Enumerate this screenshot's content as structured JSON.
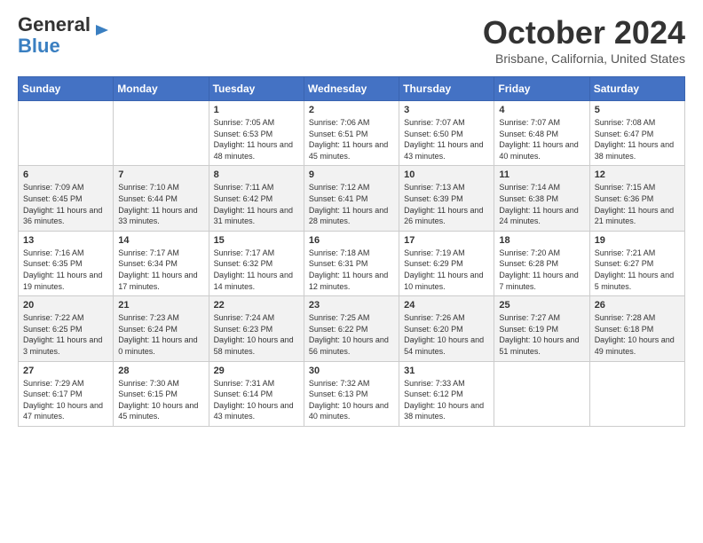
{
  "logo": {
    "line1": "General",
    "line2": "Blue"
  },
  "header": {
    "month": "October 2024",
    "location": "Brisbane, California, United States"
  },
  "columns": [
    "Sunday",
    "Monday",
    "Tuesday",
    "Wednesday",
    "Thursday",
    "Friday",
    "Saturday"
  ],
  "weeks": [
    [
      {
        "day": "",
        "info": ""
      },
      {
        "day": "",
        "info": ""
      },
      {
        "day": "1",
        "info": "Sunrise: 7:05 AM\nSunset: 6:53 PM\nDaylight: 11 hours and 48 minutes."
      },
      {
        "day": "2",
        "info": "Sunrise: 7:06 AM\nSunset: 6:51 PM\nDaylight: 11 hours and 45 minutes."
      },
      {
        "day": "3",
        "info": "Sunrise: 7:07 AM\nSunset: 6:50 PM\nDaylight: 11 hours and 43 minutes."
      },
      {
        "day": "4",
        "info": "Sunrise: 7:07 AM\nSunset: 6:48 PM\nDaylight: 11 hours and 40 minutes."
      },
      {
        "day": "5",
        "info": "Sunrise: 7:08 AM\nSunset: 6:47 PM\nDaylight: 11 hours and 38 minutes."
      }
    ],
    [
      {
        "day": "6",
        "info": "Sunrise: 7:09 AM\nSunset: 6:45 PM\nDaylight: 11 hours and 36 minutes."
      },
      {
        "day": "7",
        "info": "Sunrise: 7:10 AM\nSunset: 6:44 PM\nDaylight: 11 hours and 33 minutes."
      },
      {
        "day": "8",
        "info": "Sunrise: 7:11 AM\nSunset: 6:42 PM\nDaylight: 11 hours and 31 minutes."
      },
      {
        "day": "9",
        "info": "Sunrise: 7:12 AM\nSunset: 6:41 PM\nDaylight: 11 hours and 28 minutes."
      },
      {
        "day": "10",
        "info": "Sunrise: 7:13 AM\nSunset: 6:39 PM\nDaylight: 11 hours and 26 minutes."
      },
      {
        "day": "11",
        "info": "Sunrise: 7:14 AM\nSunset: 6:38 PM\nDaylight: 11 hours and 24 minutes."
      },
      {
        "day": "12",
        "info": "Sunrise: 7:15 AM\nSunset: 6:36 PM\nDaylight: 11 hours and 21 minutes."
      }
    ],
    [
      {
        "day": "13",
        "info": "Sunrise: 7:16 AM\nSunset: 6:35 PM\nDaylight: 11 hours and 19 minutes."
      },
      {
        "day": "14",
        "info": "Sunrise: 7:17 AM\nSunset: 6:34 PM\nDaylight: 11 hours and 17 minutes."
      },
      {
        "day": "15",
        "info": "Sunrise: 7:17 AM\nSunset: 6:32 PM\nDaylight: 11 hours and 14 minutes."
      },
      {
        "day": "16",
        "info": "Sunrise: 7:18 AM\nSunset: 6:31 PM\nDaylight: 11 hours and 12 minutes."
      },
      {
        "day": "17",
        "info": "Sunrise: 7:19 AM\nSunset: 6:29 PM\nDaylight: 11 hours and 10 minutes."
      },
      {
        "day": "18",
        "info": "Sunrise: 7:20 AM\nSunset: 6:28 PM\nDaylight: 11 hours and 7 minutes."
      },
      {
        "day": "19",
        "info": "Sunrise: 7:21 AM\nSunset: 6:27 PM\nDaylight: 11 hours and 5 minutes."
      }
    ],
    [
      {
        "day": "20",
        "info": "Sunrise: 7:22 AM\nSunset: 6:25 PM\nDaylight: 11 hours and 3 minutes."
      },
      {
        "day": "21",
        "info": "Sunrise: 7:23 AM\nSunset: 6:24 PM\nDaylight: 11 hours and 0 minutes."
      },
      {
        "day": "22",
        "info": "Sunrise: 7:24 AM\nSunset: 6:23 PM\nDaylight: 10 hours and 58 minutes."
      },
      {
        "day": "23",
        "info": "Sunrise: 7:25 AM\nSunset: 6:22 PM\nDaylight: 10 hours and 56 minutes."
      },
      {
        "day": "24",
        "info": "Sunrise: 7:26 AM\nSunset: 6:20 PM\nDaylight: 10 hours and 54 minutes."
      },
      {
        "day": "25",
        "info": "Sunrise: 7:27 AM\nSunset: 6:19 PM\nDaylight: 10 hours and 51 minutes."
      },
      {
        "day": "26",
        "info": "Sunrise: 7:28 AM\nSunset: 6:18 PM\nDaylight: 10 hours and 49 minutes."
      }
    ],
    [
      {
        "day": "27",
        "info": "Sunrise: 7:29 AM\nSunset: 6:17 PM\nDaylight: 10 hours and 47 minutes."
      },
      {
        "day": "28",
        "info": "Sunrise: 7:30 AM\nSunset: 6:15 PM\nDaylight: 10 hours and 45 minutes."
      },
      {
        "day": "29",
        "info": "Sunrise: 7:31 AM\nSunset: 6:14 PM\nDaylight: 10 hours and 43 minutes."
      },
      {
        "day": "30",
        "info": "Sunrise: 7:32 AM\nSunset: 6:13 PM\nDaylight: 10 hours and 40 minutes."
      },
      {
        "day": "31",
        "info": "Sunrise: 7:33 AM\nSunset: 6:12 PM\nDaylight: 10 hours and 38 minutes."
      },
      {
        "day": "",
        "info": ""
      },
      {
        "day": "",
        "info": ""
      }
    ]
  ]
}
